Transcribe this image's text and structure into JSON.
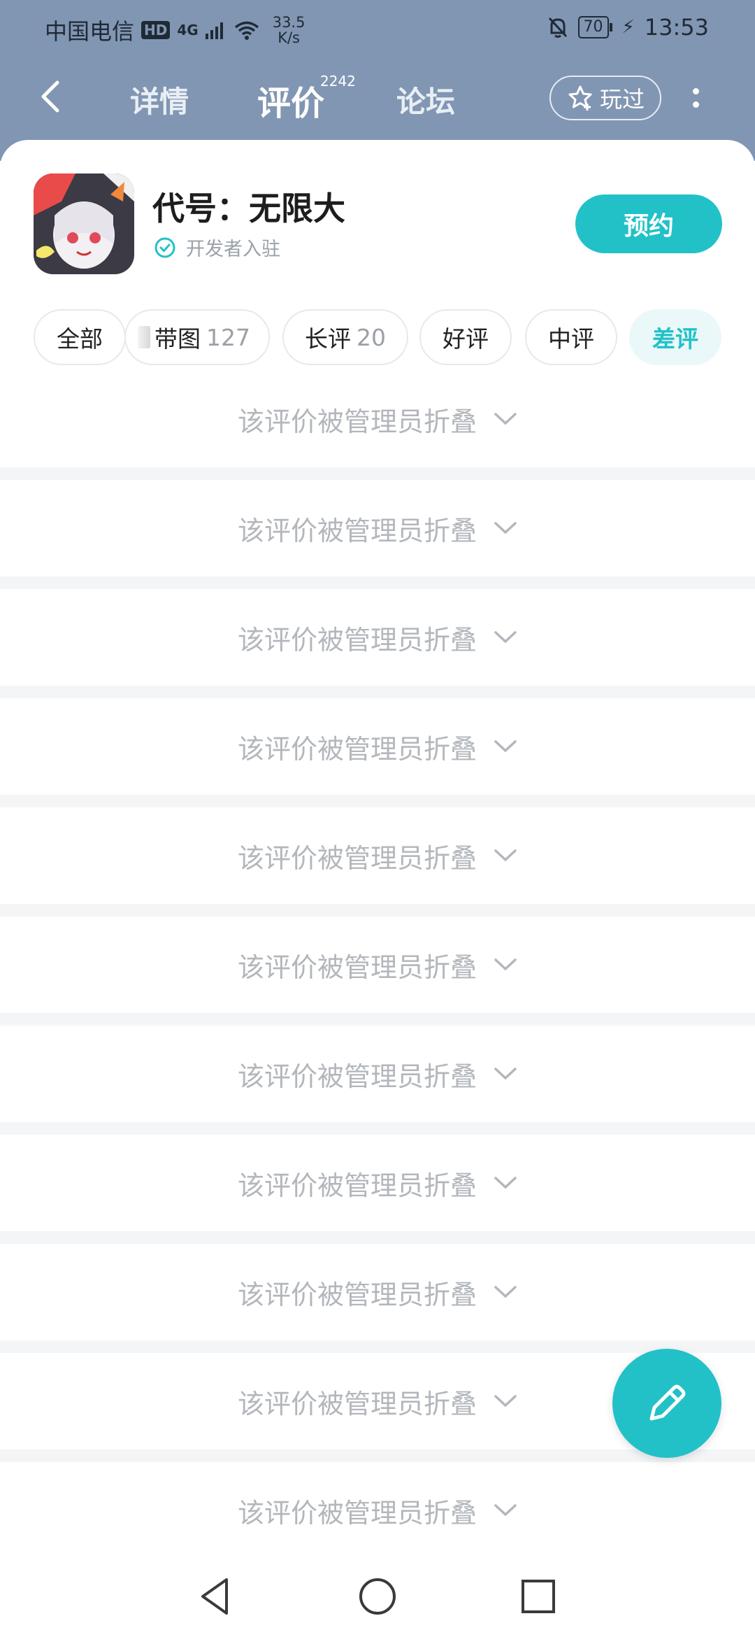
{
  "status_bar": {
    "carrier": "中国电信",
    "hd": "HD",
    "network": "4G",
    "speed_value": "33.5",
    "speed_unit": "K/s",
    "battery": "70",
    "time": "13:53"
  },
  "nav": {
    "tabs": [
      {
        "label": "详情"
      },
      {
        "label": "评价"
      },
      {
        "label": "论坛"
      }
    ],
    "reviews_count": "2242",
    "played_label": "玩过"
  },
  "game": {
    "title": "代号：无限大",
    "developer_badge": "开发者入驻",
    "reserve_label": "预约"
  },
  "filters": [
    {
      "label": "全部",
      "count": ""
    },
    {
      "label": "带图",
      "count": "127"
    },
    {
      "label": "长评",
      "count": "20"
    },
    {
      "label": "好评",
      "count": ""
    },
    {
      "label": "中评",
      "count": ""
    },
    {
      "label": "差评",
      "count": ""
    }
  ],
  "active_filter": "差评",
  "folded_reviews": [
    {
      "text": "该评价被管理员折叠"
    },
    {
      "text": "该评价被管理员折叠"
    },
    {
      "text": "该评价被管理员折叠"
    },
    {
      "text": "该评价被管理员折叠"
    },
    {
      "text": "该评价被管理员折叠"
    },
    {
      "text": "该评价被管理员折叠"
    },
    {
      "text": "该评价被管理员折叠"
    },
    {
      "text": "该评价被管理员折叠"
    },
    {
      "text": "该评价被管理员折叠"
    },
    {
      "text": "该评价被管理员折叠"
    },
    {
      "text": "该评价被管理员折叠"
    }
  ],
  "colors": {
    "header_bg": "#8196b2",
    "accent": "#22c1c8",
    "folded_text": "#b3b7bc",
    "separator": "#f4f5f7"
  },
  "icons": {
    "back": "chevron-left-icon",
    "played": "star-plus-icon",
    "more": "more-vertical-icon",
    "developer": "check-circle-icon",
    "expand": "chevron-down-icon",
    "write": "pencil-icon"
  }
}
